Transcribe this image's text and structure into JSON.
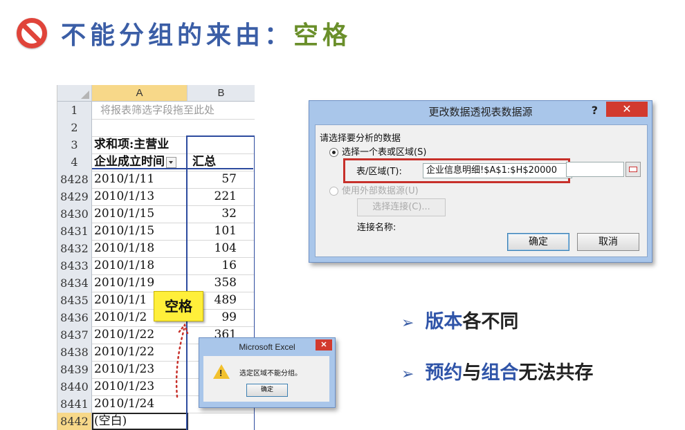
{
  "title": {
    "main": "不能分组的来由：",
    "highlight": "空格"
  },
  "sheet": {
    "columns": [
      "A",
      "B"
    ],
    "rows": [
      {
        "num": "1",
        "a": "将报表筛选字段拖至此处",
        "b": ""
      },
      {
        "num": "2",
        "a": "",
        "b": ""
      },
      {
        "num": "3",
        "a": "求和项:主营业",
        "b": ""
      },
      {
        "num": "4",
        "a": "企业成立时间",
        "b": "汇总"
      },
      {
        "num": "8428",
        "a": "2010/1/11",
        "b": "57"
      },
      {
        "num": "8429",
        "a": "2010/1/13",
        "b": "221"
      },
      {
        "num": "8430",
        "a": "2010/1/15",
        "b": "32"
      },
      {
        "num": "8431",
        "a": "2010/1/15",
        "b": "101"
      },
      {
        "num": "8432",
        "a": "2010/1/18",
        "b": "104"
      },
      {
        "num": "8433",
        "a": "2010/1/18",
        "b": "16"
      },
      {
        "num": "8434",
        "a": "2010/1/19",
        "b": "358"
      },
      {
        "num": "8435",
        "a": "2010/1/1",
        "b": "489"
      },
      {
        "num": "8436",
        "a": "2010/1/2",
        "b": "99"
      },
      {
        "num": "8437",
        "a": "2010/1/22",
        "b": "361"
      },
      {
        "num": "8438",
        "a": "2010/1/22",
        "b": ""
      },
      {
        "num": "8439",
        "a": "2010/1/23",
        "b": ""
      },
      {
        "num": "8440",
        "a": "2010/1/23",
        "b": ""
      },
      {
        "num": "8441",
        "a": "2010/1/24",
        "b": ""
      },
      {
        "num": "8442",
        "a": "(空白)",
        "b": ""
      }
    ]
  },
  "callout": {
    "label": "空格"
  },
  "pivot_dialog": {
    "title": "更改数据透视表数据源",
    "help": "?",
    "close": "✕",
    "prompt": "请选择要分析的数据",
    "option1": "选择一个表或区域(S)",
    "range_label": "表/区域(T):",
    "range_value": "企业信息明细!$A$1:$H$20000",
    "option2": "使用外部数据源(U)",
    "choose_conn": "选择连接(C)...",
    "conn_name": "连接名称:",
    "ok": "确定",
    "cancel": "取消"
  },
  "bullets": [
    {
      "arrow": "➢",
      "blue": "版本",
      "rest": "各不同"
    },
    {
      "arrow": "➢",
      "blue1": "预约",
      "mid": "与",
      "blue2": "组合",
      "rest": "无法共存"
    }
  ],
  "excel_dialog": {
    "title": "Microsoft Excel",
    "close": "✕",
    "message": "选定区域不能分组。",
    "ok": "确定"
  },
  "colors": {
    "accent_blue": "#3b5ea6",
    "highlight_green": "#6a8f2a",
    "alert_red": "#c7302a",
    "callout_yellow": "#ffef3a"
  }
}
